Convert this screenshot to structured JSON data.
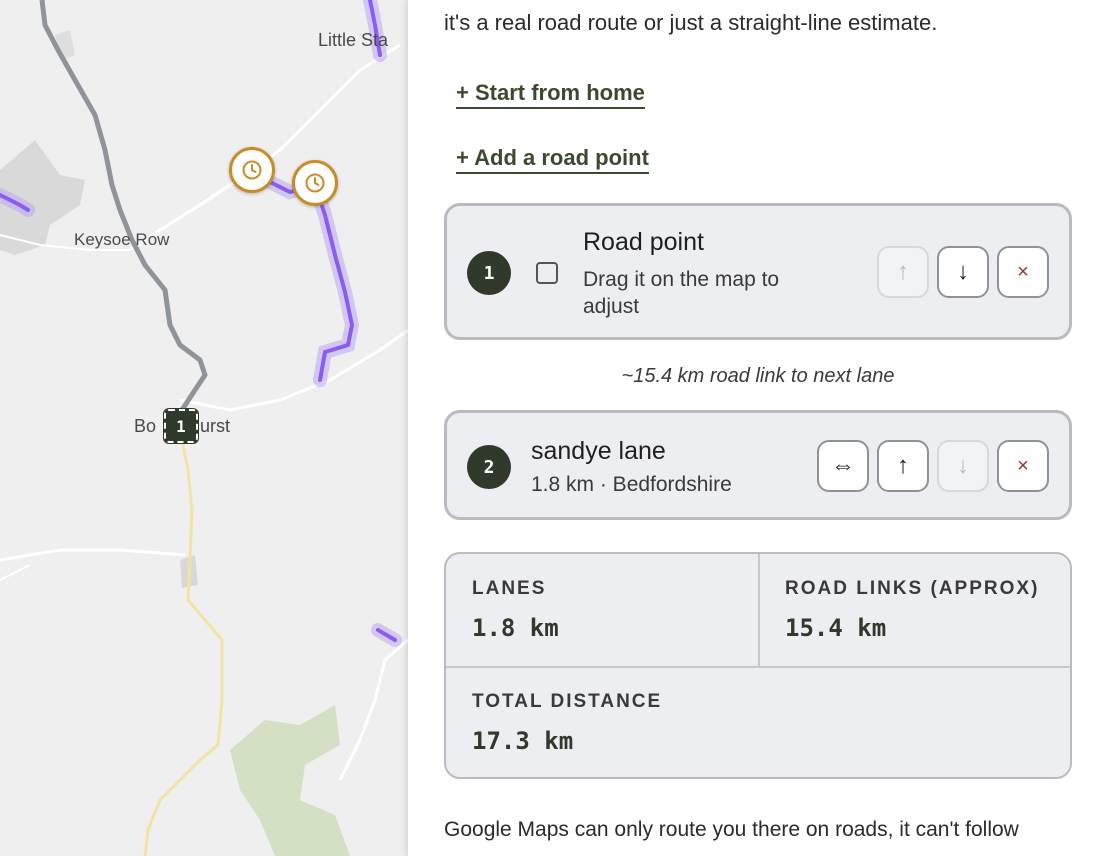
{
  "map": {
    "place_labels": [
      "Little Sta",
      "Keysoe Row",
      "Bo",
      "urst"
    ],
    "road_point_marker": "1",
    "clock_marker_icon": "clock-icon",
    "colors": {
      "route_gray": "#8f949b",
      "lane_purple": "#8a5cf0",
      "road_yellow": "#f3e3a3",
      "woods_green": "#cfe0b4"
    }
  },
  "panel": {
    "intro_text": "it's a real road route or just a straight-line estimate.",
    "start_from_home": "+ Start from home",
    "add_road_point": "+ Add a road point",
    "stops": [
      {
        "number": "1",
        "title": "Road point",
        "subtitle": "Drag it on the map to adjust",
        "buttons": {
          "up": "↑",
          "down": "↓",
          "remove": "×"
        }
      },
      {
        "number": "2",
        "title": "sandye lane",
        "subtitle": "1.8 km · Bedfordshire",
        "buttons": {
          "reverse": "⇔",
          "up": "↑",
          "down": "↓",
          "remove": "×"
        }
      }
    ],
    "link_note": "~15.4 km road link to next lane",
    "stats": {
      "lanes_label": "LANES",
      "lanes_value": "1.8 km",
      "links_label": "ROAD LINKS (APPROX)",
      "links_value": "15.4 km",
      "total_label": "TOTAL DISTANCE",
      "total_value": "17.3 km"
    },
    "footer_text": "Google Maps can only route you there on roads, it can't follow"
  }
}
